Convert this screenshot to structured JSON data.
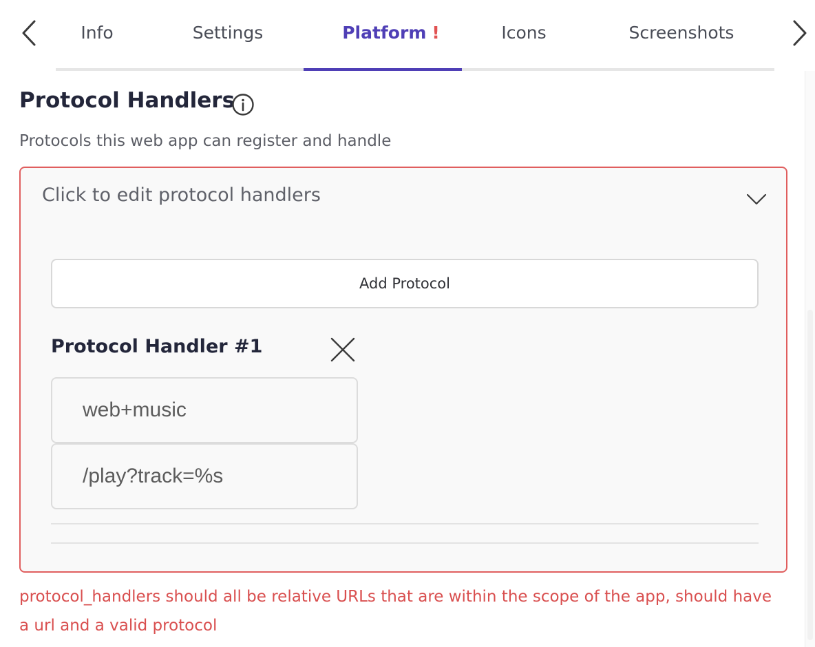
{
  "tabs": {
    "items": [
      {
        "label": "Info"
      },
      {
        "label": "Settings"
      },
      {
        "label": "Platform",
        "badge": "!",
        "active": true
      },
      {
        "label": "Icons"
      },
      {
        "label": "Screenshots"
      }
    ],
    "prev_icon": "chevron-left-icon",
    "next_icon": "chevron-right-icon",
    "active_color": "#4f3fb6",
    "warning_color": "#e15252"
  },
  "section": {
    "title": "Protocol Handlers",
    "info_icon": "info-icon",
    "description": "Protocols this web app can register and handle"
  },
  "panel": {
    "header": "Click to edit protocol handlers",
    "expand_icon": "chevron-down-icon",
    "expanded": true,
    "border_color": "#e05e5e",
    "add_button": "Add Protocol",
    "handlers": [
      {
        "title": "Protocol Handler #1",
        "remove_icon": "close-icon",
        "protocol": "web+music",
        "url": "/play?track=%s"
      }
    ]
  },
  "error": {
    "message": "protocol_handlers should all be relative URLs that are within the scope of the app, should have a url and a valid protocol",
    "color": "#d94f4f"
  }
}
